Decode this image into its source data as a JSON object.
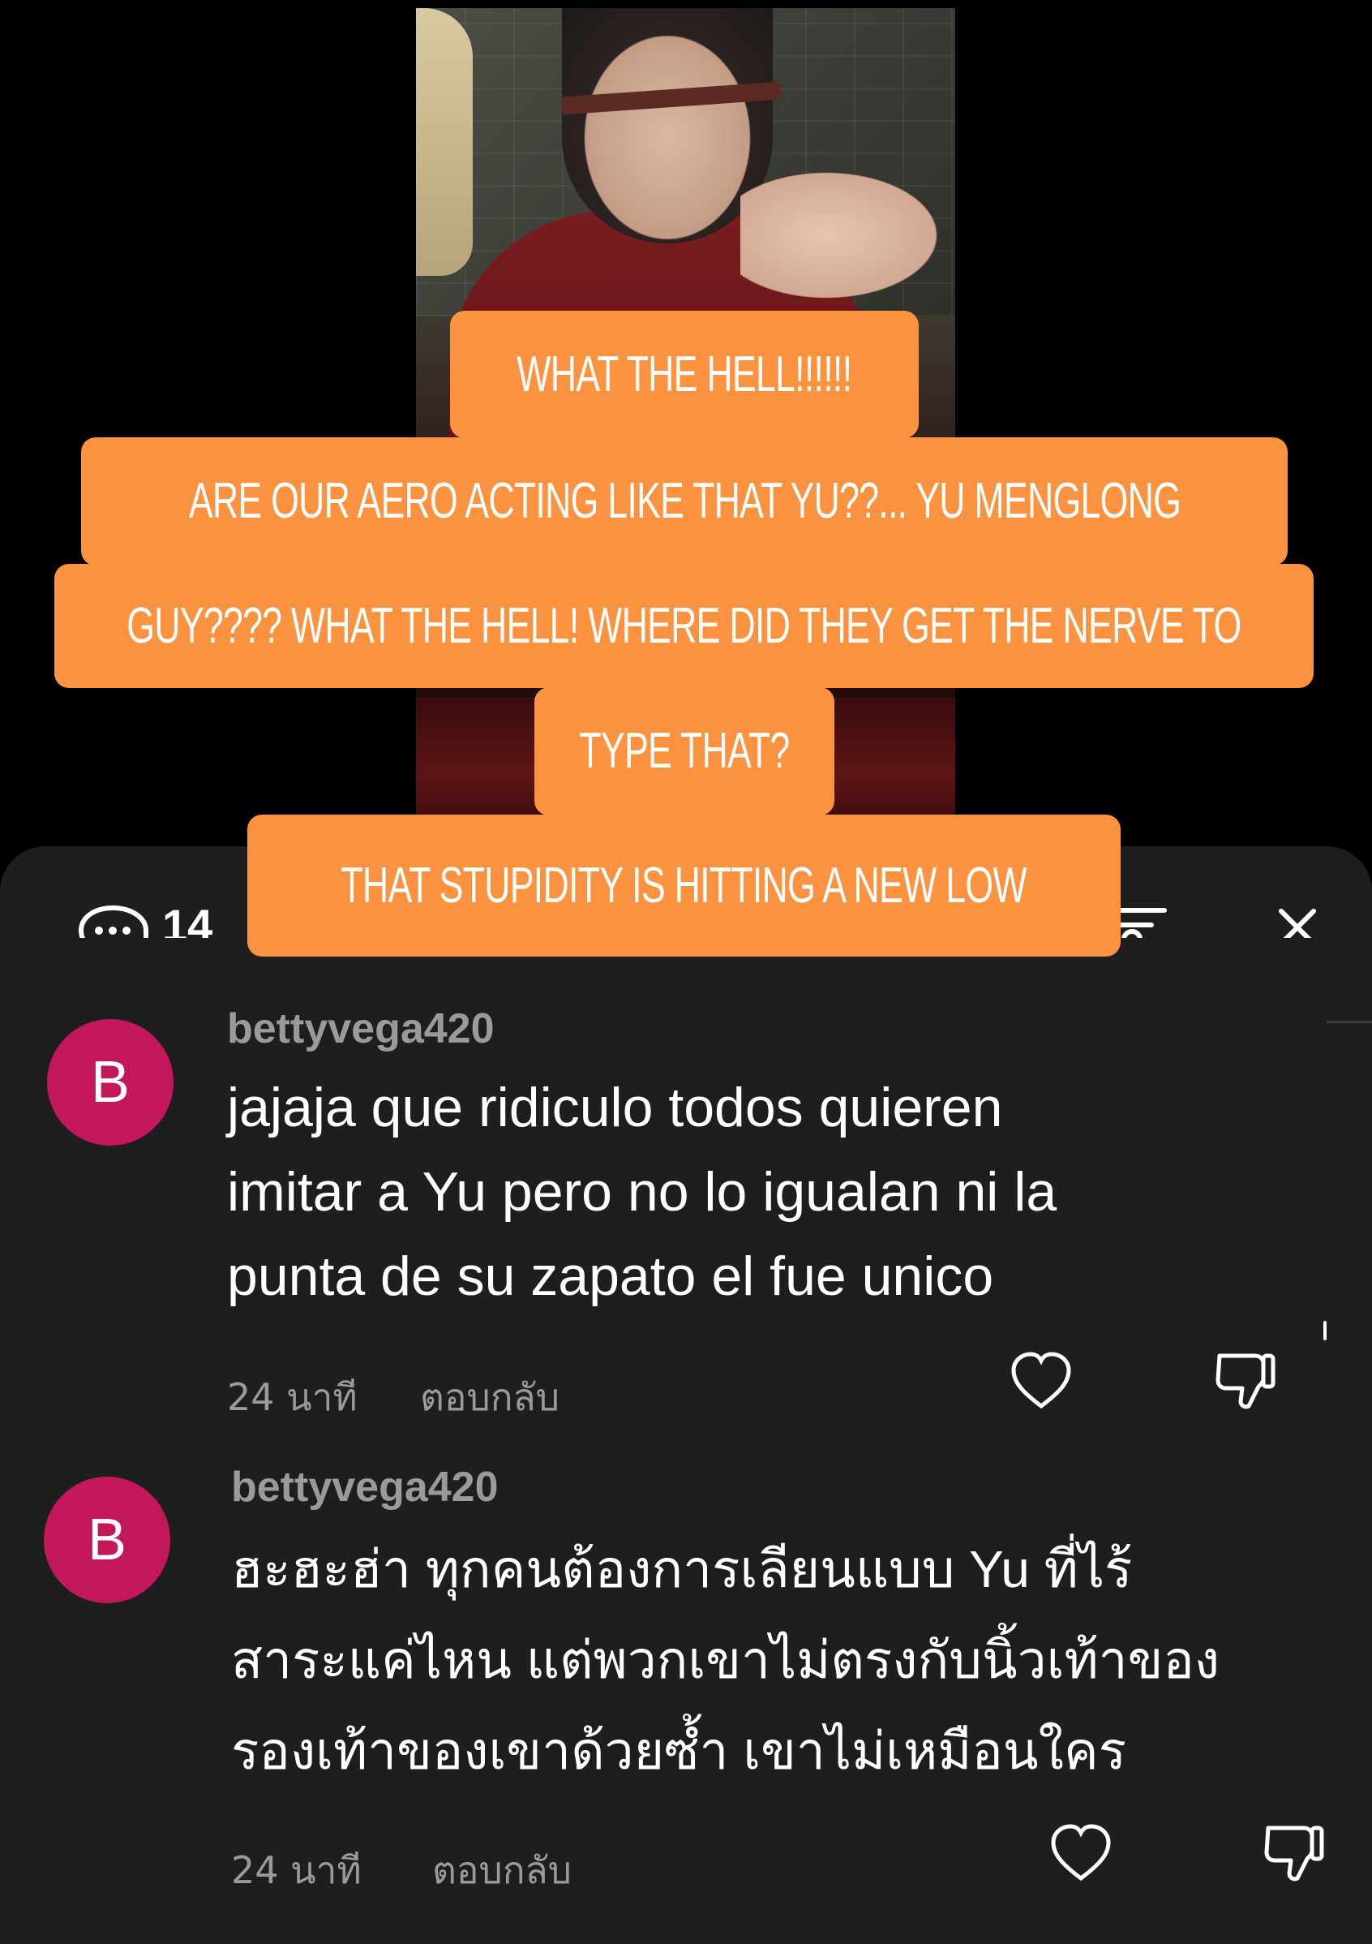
{
  "captions": {
    "line1": "WHAT THE HELL!!!!!!",
    "line2": "ARE OUR AERO ACTING LIKE THAT YU??... YU MENGLONG",
    "line3": "GUY???? WHAT THE HELL! WHERE DID THEY GET THE NERVE TO",
    "line4": "TYPE THAT?",
    "line5": "THAT STUPIDITY IS HITTING A NEW LOW"
  },
  "comments_header": {
    "count": "14",
    "icons": [
      "comment-bubble-icon",
      "filter-icon",
      "close-icon"
    ]
  },
  "comments": [
    {
      "avatar_letter": "B",
      "username": "bettyvega420",
      "text": "jajaja que ridiculo todos quieren\nimitar a Yu pero no lo igualan ni la\npunta de su zapato el fue unico",
      "time": "24 นาที",
      "reply": "ตอบกลับ"
    },
    {
      "avatar_letter": "B",
      "username": "bettyvega420",
      "text": "ฮะฮะฮ่า ทุกคนต้องการเลียนแบบ Yu ที่ไร้\nสาระแค่ไหน แต่พวกเขาไม่ตรงกับนิ้วเท้าของ\nรองเท้าของเขาด้วยซ้ำ เขาไม่เหมือนใคร",
      "time": "24 นาที",
      "reply": "ตอบกลับ"
    }
  ],
  "colors": {
    "caption_bg": "#fb923f",
    "sheet_bg": "#1e1e1f",
    "avatar_bg": "#c2185b",
    "meta_text": "#9a9a9c"
  }
}
